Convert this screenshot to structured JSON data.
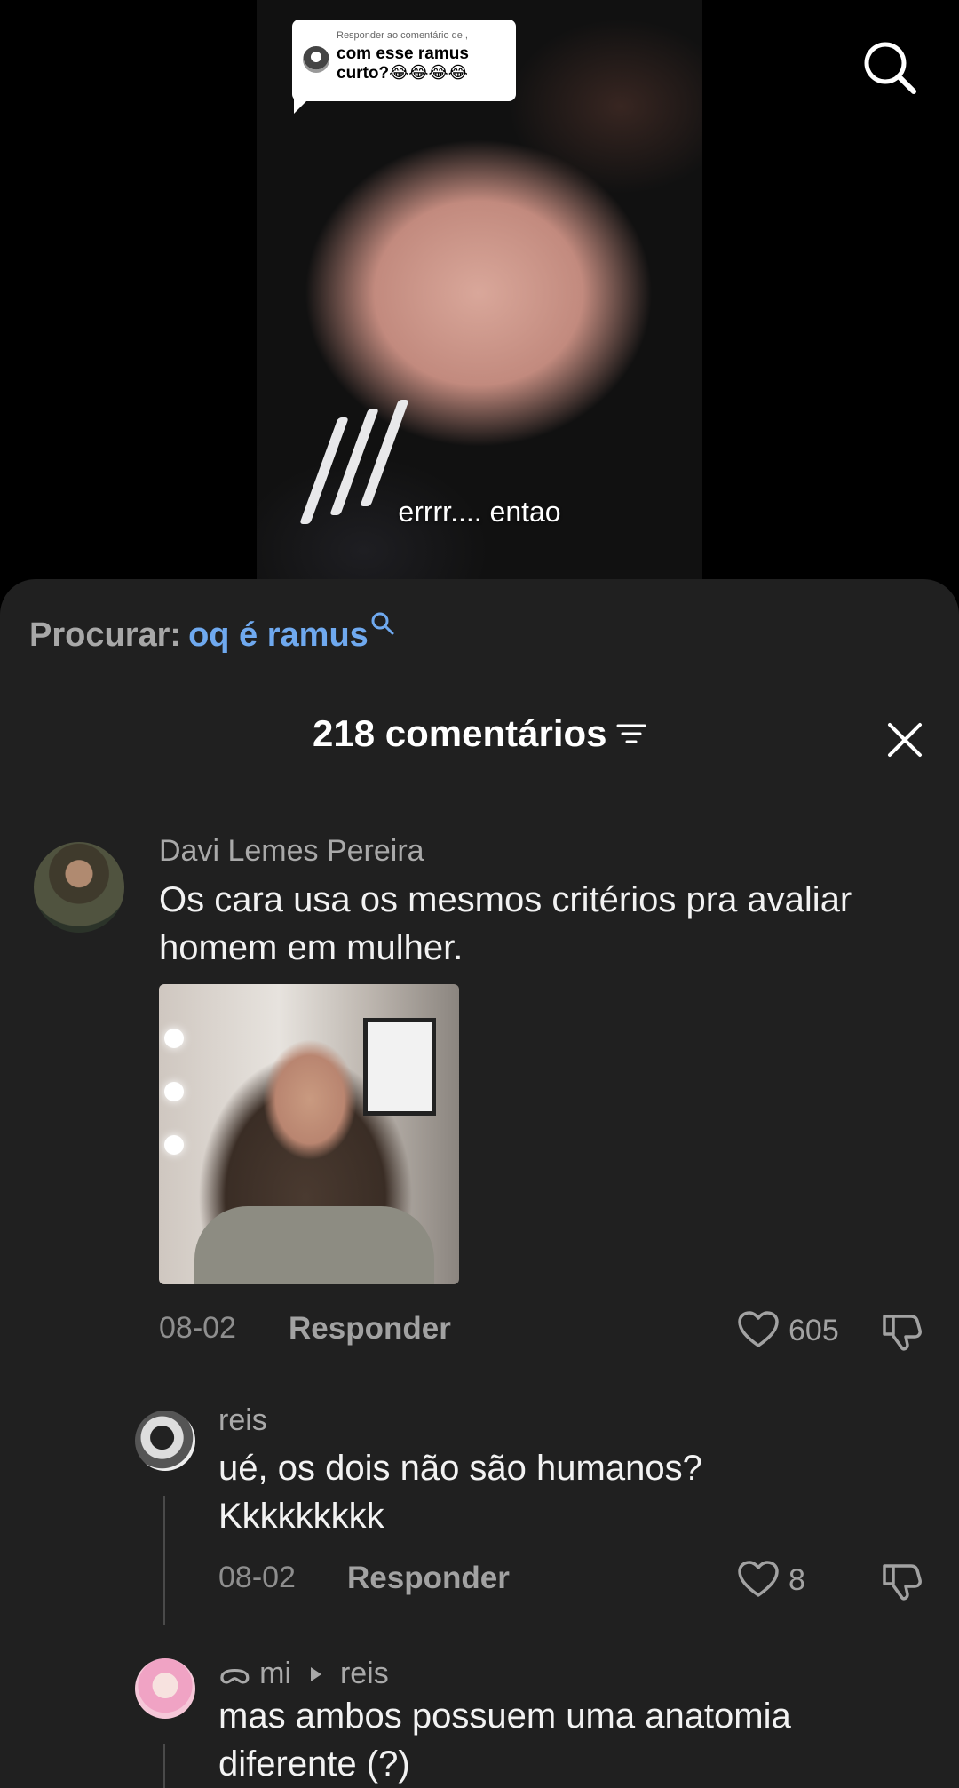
{
  "video": {
    "reply_label": "Responder ao comentário de ,",
    "reply_text": "com esse ramus curto?😂😂😂😂",
    "caption": "errrr.... entao",
    "search_icon": "search-icon"
  },
  "search": {
    "prefix": "Procurar:",
    "query": "oq é ramus"
  },
  "comments_header": {
    "count_label": "218 comentários",
    "sort_icon": "sort-icon",
    "close_icon": "close-icon"
  },
  "comments": [
    {
      "author": "Davi Lemes Pereira",
      "text": "Os cara usa os mesmos critérios pra avaliar homem em mulher.",
      "date": "08-02",
      "reply_label": "Responder",
      "likes": "605",
      "has_image": true
    },
    {
      "author": "reis",
      "text": "ué, os dois não são humanos? Kkkkkkkkk",
      "date": "08-02",
      "reply_label": "Responder",
      "likes": "8"
    },
    {
      "author_prefix": "ᯅ mi",
      "reply_to": "reis",
      "text": "mas ambos possuem uma anatomia diferente (?)"
    }
  ],
  "colors": {
    "panel_bg": "#202020",
    "link_blue": "#6fa9ef",
    "muted_text": "#a9a9a9"
  }
}
